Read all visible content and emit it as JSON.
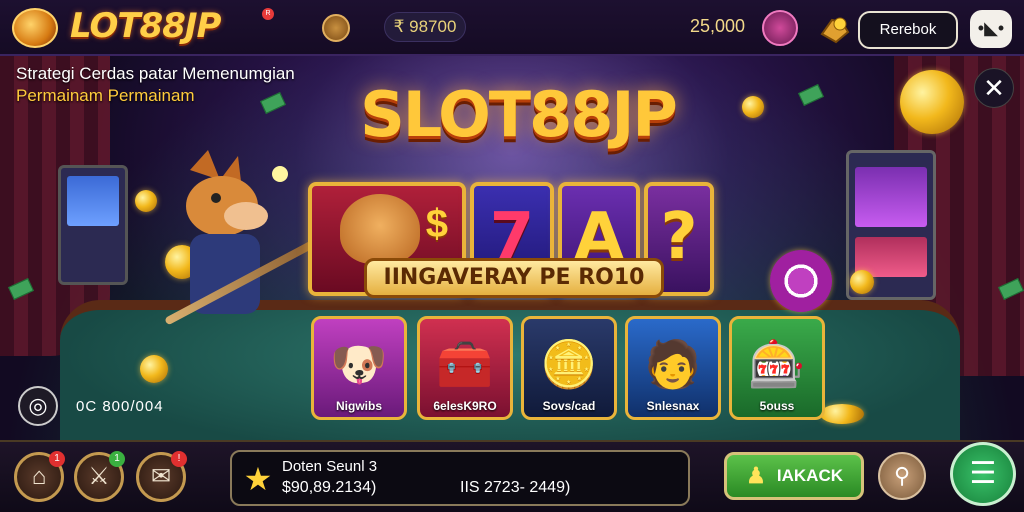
{
  "header": {
    "logo_text": "LOT88JP",
    "logo_tm": "R",
    "balance_pill": "₹ 98700",
    "balance_right": "25,000",
    "refresh_label": "Rerebok"
  },
  "promo": {
    "headline": "Strategi Cerdas patar Memenumgian",
    "subline": "Permainam Permainam",
    "big_title": "SLOT88JP",
    "banner": "IINGAVERAY PE RO10",
    "reel_symbols": [
      "7",
      "A",
      "?"
    ],
    "reel_dollar": "$"
  },
  "games": [
    {
      "label": "Nigwibs",
      "glyph": "🐶"
    },
    {
      "label": "6elesK9RO",
      "glyph": "🧰"
    },
    {
      "label": "Sovs/cad",
      "glyph": "🪙"
    },
    {
      "label": "Snlesnax",
      "glyph": "🧑"
    },
    {
      "label": "5ouss",
      "glyph": "🎰"
    }
  ],
  "side": {
    "balance_text": "0C 800/004"
  },
  "footer": {
    "nav": [
      {
        "icon": "⌂",
        "badge": "1"
      },
      {
        "icon": "⚔",
        "badge": "1"
      },
      {
        "icon": "✉",
        "badge": "!"
      }
    ],
    "info_title": "Doten Seunl 3",
    "info_value": "$90,89.2134)",
    "info_range": "IIS 2723- 2449)",
    "star_icon": "★",
    "action_label": "IAKACK",
    "pin_icon": "⚲",
    "menu_icon": "☰"
  },
  "controls": {
    "close_icon": "✕",
    "top_menu_icon": "•◣•",
    "settings_icon": "◎"
  },
  "colors": {
    "accent_gold": "#ffc83a",
    "action_green": "#2a8a24",
    "bg_purple": "#24103f"
  }
}
